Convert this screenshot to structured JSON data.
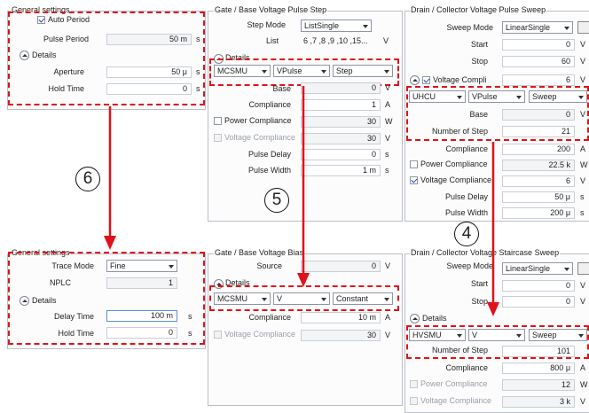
{
  "top": {
    "general": {
      "title": "General settings",
      "auto_period_label": "Auto Period",
      "auto_period_checked": true,
      "pulse_period_label": "Pulse Period",
      "pulse_period_value": "50 m",
      "pulse_period_unit": "s",
      "details_label": "Details",
      "aperture_label": "Aperture",
      "aperture_value": "50 μ",
      "aperture_unit": "s",
      "hold_time_label": "Hold Time",
      "hold_time_value": "0",
      "hold_time_unit": "s"
    },
    "gate": {
      "title": "Gate / Base Voltage Pulse Step",
      "step_mode_label": "Step Mode",
      "step_mode_value": "ListSingle",
      "list_label": "List",
      "list_value": "6 ,7 ,8 ,9 ,10 ,15...",
      "list_unit": "V",
      "details_label": "Details",
      "smu": "MCSMU",
      "func": "VPulse",
      "mode": "Step",
      "base_label": "Base",
      "base_value": "0",
      "base_unit": "V",
      "compliance_label": "Compliance",
      "compliance_value": "1",
      "compliance_unit": "A",
      "power_compliance_label": "Power Compliance",
      "power_compliance_value": "30",
      "power_compliance_unit": "W",
      "voltage_compliance_label": "Voltage Compliance",
      "voltage_compliance_value": "30",
      "voltage_compliance_unit": "V",
      "pulse_delay_label": "Pulse Delay",
      "pulse_delay_value": "0",
      "pulse_delay_unit": "s",
      "pulse_width_label": "Pulse Width",
      "pulse_width_value": "1 m",
      "pulse_width_unit": "s"
    },
    "drain": {
      "title": "Drain / Collector Voltage Pulse Sweep",
      "sweep_mode_label": "Sweep Mode",
      "sweep_mode_value": "LinearSingle",
      "start_label": "Start",
      "start_value": "0",
      "start_unit": "V",
      "stop_label": "Stop",
      "stop_value": "60",
      "stop_unit": "V",
      "voltage_compliance_label": "Voltage Compli",
      "voltage_compliance_value": "6",
      "voltage_compliance_unit": "V",
      "smu": "UHCU",
      "func": "VPulse",
      "mode": "Sweep",
      "base_label": "Base",
      "base_value": "0",
      "base_unit": "V",
      "num_step_label": "Number of Step",
      "num_step_value": "21",
      "compliance_label": "Compliance",
      "compliance_value": "200",
      "compliance_unit": "A",
      "power_compliance_label": "Power Compliance",
      "power_compliance_value": "22.5 k",
      "power_compliance_unit": "W",
      "voltage_compliance2_label": "Voltage Compliance",
      "voltage_compliance2_value": "6",
      "voltage_compliance2_unit": "V",
      "pulse_delay_label": "Pulse Delay",
      "pulse_delay_value": "50 μ",
      "pulse_delay_unit": "s",
      "pulse_width_label": "Pulse Width",
      "pulse_width_value": "200 μ",
      "pulse_width_unit": "s"
    }
  },
  "bottom": {
    "general": {
      "title": "General settings",
      "trace_mode_label": "Trace Mode",
      "trace_mode_value": "Fine",
      "nplc_label": "NPLC",
      "nplc_value": "1",
      "details_label": "Details",
      "delay_time_label": "Delay Time",
      "delay_time_value": "100 m",
      "delay_time_unit": "s",
      "hold_time_label": "Hold Time",
      "hold_time_value": "0",
      "hold_time_unit": "s"
    },
    "gate": {
      "title": "Gate / Base Voltage Bias",
      "source_label": "Source",
      "source_value": "0",
      "source_unit": "V",
      "details_label": "Details",
      "smu": "MCSMU",
      "func": "V",
      "mode": "Constant",
      "compliance_label": "Compliance",
      "compliance_value": "10 m",
      "compliance_unit": "A",
      "voltage_compliance_label": "Voltage Compliance",
      "voltage_compliance_value": "30",
      "voltage_compliance_unit": "V"
    },
    "drain": {
      "title": "Drain / Collector Voltage Staircase Sweep",
      "sweep_mode_label": "Sweep Mode",
      "sweep_mode_value": "LinearSingle",
      "start_label": "Start",
      "start_value": "0",
      "start_unit": "V",
      "stop_label": "Stop",
      "stop_value": "0",
      "stop_unit": "V",
      "details_label": "Details",
      "smu": "HVSMU",
      "func": "V",
      "mode": "Sweep",
      "num_step_label": "Number of Step",
      "num_step_value": "101",
      "compliance_label": "Compliance",
      "compliance_value": "800 μ",
      "compliance_unit": "A",
      "power_compliance_label": "Power Compliance",
      "power_compliance_value": "12",
      "power_compliance_unit": "W",
      "voltage_compliance_label": "Voltage Compliance",
      "voltage_compliance_value": "3 k",
      "voltage_compliance_unit": "V"
    }
  },
  "callouts": {
    "c6": "6",
    "c5": "5",
    "c4": "4"
  },
  "colors": {
    "highlight": "#e1111a",
    "panel_border": "#b9bec8"
  }
}
